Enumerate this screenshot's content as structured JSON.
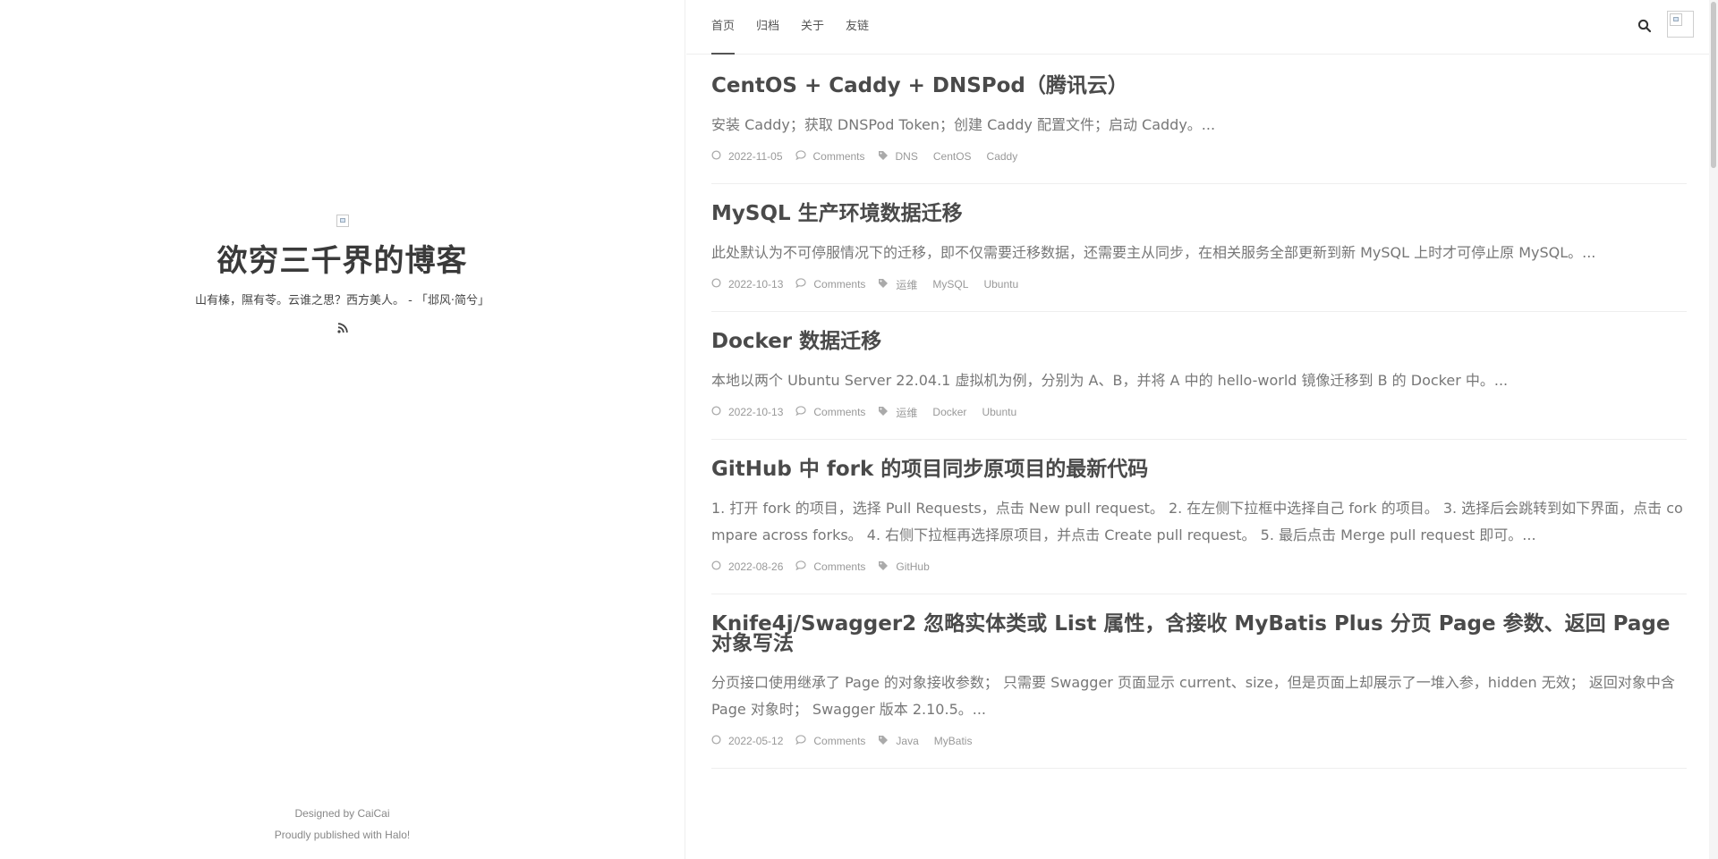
{
  "site": {
    "title": "欲穷三千界的博客",
    "description": "山有榛，隰有苓。云谁之思？西方美人。 - 「邶风·简兮」",
    "footer_designed": "Designed by CaiCai",
    "footer_published": "Proudly published with Halo!"
  },
  "nav": {
    "items": [
      "首页",
      "归档",
      "关于",
      "友链"
    ],
    "active_index": 0
  },
  "posts": [
    {
      "title": "CentOS + Caddy + DNSPod（腾讯云）",
      "excerpt": "安装 Caddy；获取 DNSPod Token；创建 Caddy 配置文件；启动 Caddy。...",
      "date": "2022-11-05",
      "comments": "Comments",
      "tags": [
        "DNS",
        "CentOS",
        "Caddy"
      ]
    },
    {
      "title": "MySQL 生产环境数据迁移",
      "excerpt": "此处默认为不可停服情况下的迁移，即不仅需要迁移数据，还需要主从同步，在相关服务全部更新到新 MySQL 上时才可停止原 MySQL。...",
      "date": "2022-10-13",
      "comments": "Comments",
      "tags": [
        "运维",
        "MySQL",
        "Ubuntu"
      ]
    },
    {
      "title": "Docker 数据迁移",
      "excerpt": "本地以两个 Ubuntu Server 22.04.1 虚拟机为例，分别为 A、B，并将 A 中的 hello-world 镜像迁移到 B 的 Docker 中。...",
      "date": "2022-10-13",
      "comments": "Comments",
      "tags": [
        "运维",
        "Docker",
        "Ubuntu"
      ]
    },
    {
      "title": "GitHub 中 fork 的项目同步原项目的最新代码",
      "excerpt": "1. 打开 fork 的项目，选择 Pull Requests，点击 New pull request。 2. 在左侧下拉框中选择自己 fork 的项目。 3. 选择后会跳转到如下界面，点击 compare across forks。 4. 右侧下拉框再选择原项目，并点击 Create pull request。 5. 最后点击 Merge pull request 即可。...",
      "date": "2022-08-26",
      "comments": "Comments",
      "tags": [
        "GitHub"
      ]
    },
    {
      "title": "Knife4j/Swagger2 忽略实体类或 List 属性，含接收 MyBatis Plus 分页 Page 参数、返回 Page 对象写法",
      "excerpt": "分页接口使用继承了 Page 的对象接收参数； 只需要 Swagger 页面显示 current、size，但是页面上却展示了一堆入参，hidden 无效； 返回对象中含 Page 对象时； Swagger 版本 2.10.5。...",
      "date": "2022-05-12",
      "comments": "Comments",
      "tags": [
        "Java",
        "MyBatis"
      ]
    }
  ],
  "icons": {
    "search": "search-icon",
    "rss": "rss-icon",
    "date": "clock-icon",
    "comments": "comment-icon",
    "tags": "tag-icon"
  }
}
